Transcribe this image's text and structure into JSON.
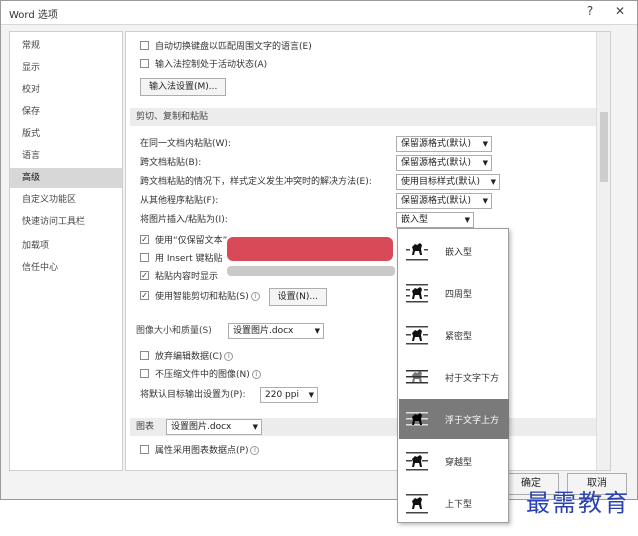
{
  "window": {
    "title": "Word 选项",
    "help_glyph": "?",
    "close_glyph": "✕"
  },
  "sidebar": {
    "items": [
      {
        "label": "常规"
      },
      {
        "label": "显示"
      },
      {
        "label": "校对"
      },
      {
        "label": "保存"
      },
      {
        "label": "版式"
      },
      {
        "label": "语言"
      },
      {
        "label": "高级",
        "selected": true
      },
      {
        "label": "自定义功能区"
      },
      {
        "label": "快速访问工具栏"
      },
      {
        "label": "加载项"
      },
      {
        "label": "信任中心"
      }
    ]
  },
  "content": {
    "top_rows": {
      "auto_keyboard": "自动切换键盘以匹配周围文字的语言(E)",
      "ime_control": "输入法控制处于活动状态(A)",
      "ime_settings_button": "输入法设置(M)..."
    },
    "paste_section": {
      "header": "剪切、复制和粘贴",
      "rows": [
        {
          "label": "在同一文档内粘贴(W):",
          "value": "保留源格式(默认)"
        },
        {
          "label": "跨文档粘贴(B):",
          "value": "保留源格式(默认)"
        },
        {
          "label": "跨文档粘贴的情况下，样式定义发生冲突时的解决方法(E):",
          "value": "使用目标样式(默认)"
        },
        {
          "label": "从其他程序粘贴(F):",
          "value": "保留源格式(默认)"
        },
        {
          "label": "将图片插入/粘贴为(I):",
          "value": "嵌入型"
        }
      ],
      "cb_keep_text": "使用“仅保留文本”",
      "cb_insert_key": "用 Insert 键粘贴",
      "cb_paste_options": "粘贴内容时显示",
      "cb_smart_cut": "使用智能剪切和粘贴(S)",
      "settings_button": "设置(N)..."
    },
    "image_section": {
      "header": "图像大小和质量(S)",
      "doc_select": "设置图片.docx",
      "cb_discard_edit": "放弃编辑数据(C)",
      "cb_no_compress": "不压缩文件中的图像(N)",
      "resolution_label": "将默认目标输出设置为(P):",
      "resolution_value": "220 ppi"
    },
    "chart_section": {
      "header": "图表",
      "doc_select": "设置图片.docx",
      "cb_chart_props": "属性采用图表数据点(P)"
    }
  },
  "footer": {
    "ok_label": "确定",
    "cancel_label": "取消"
  },
  "wrap_popup": {
    "items": [
      {
        "label": "嵌入型",
        "icon": "inline-wrap-icon"
      },
      {
        "label": "四周型",
        "icon": "square-wrap-icon"
      },
      {
        "label": "紧密型",
        "icon": "tight-wrap-icon"
      },
      {
        "label": "衬于文字下方",
        "icon": "behind-text-icon"
      },
      {
        "label": "浮于文字上方",
        "icon": "in-front-of-text-icon",
        "highlighted": true
      },
      {
        "label": "穿越型",
        "icon": "through-wrap-icon"
      },
      {
        "label": "上下型",
        "icon": "top-bottom-wrap-icon"
      }
    ]
  },
  "watermark": "最需教育",
  "colors": {
    "selected_sidebar": "#d7d7d7",
    "popup_highlight": "#7a7a7a",
    "redaction": "#d84a58",
    "watermark": "#2a43b0"
  }
}
